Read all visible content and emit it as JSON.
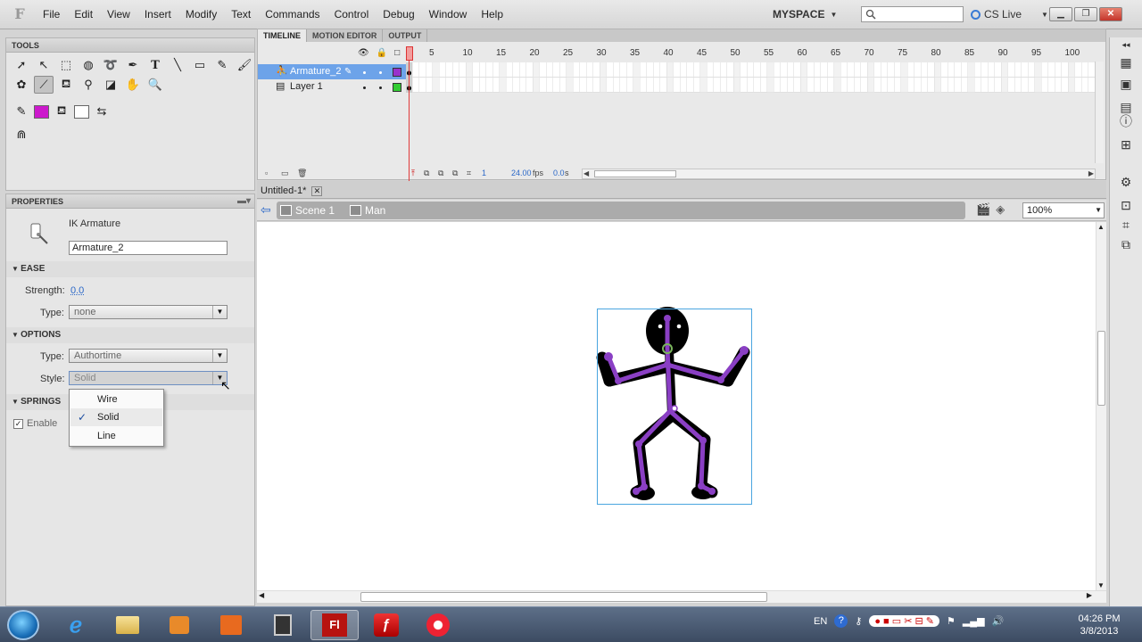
{
  "menu": {
    "items": [
      "File",
      "Edit",
      "View",
      "Insert",
      "Modify",
      "Text",
      "Commands",
      "Control",
      "Debug",
      "Window",
      "Help"
    ],
    "workspace": "MYSPACE",
    "search_placeholder": "",
    "cs_live": "CS Live"
  },
  "tools_panel": {
    "title": "TOOLS",
    "stroke_color": "#cc19cc",
    "fill_color": "#ffffff"
  },
  "properties": {
    "title": "PROPERTIES",
    "object_type": "IK Armature",
    "name_value": "Armature_2",
    "ease": {
      "heading": "EASE",
      "strength_label": "Strength:",
      "strength_value": "0.0",
      "type_label": "Type:",
      "type_value": "none"
    },
    "options": {
      "heading": "OPTIONS",
      "type_label": "Type:",
      "type_value": "Authortime",
      "style_label": "Style:",
      "style_value": "Solid"
    },
    "springs": {
      "heading": "SPRINGS",
      "enable_label": "Enable",
      "enable_checked": true
    },
    "style_dropdown": {
      "options": [
        "Wire",
        "Solid",
        "Line"
      ],
      "selected": "Solid"
    }
  },
  "timeline": {
    "tabs": [
      "TIMELINE",
      "MOTION EDITOR",
      "OUTPUT"
    ],
    "active_tab": "TIMELINE",
    "ruler": [
      "1",
      "5",
      "10",
      "15",
      "20",
      "25",
      "30",
      "35",
      "40",
      "45",
      "50",
      "55",
      "60",
      "65",
      "70",
      "75",
      "80",
      "85",
      "90",
      "95",
      "100"
    ],
    "layers": [
      {
        "name": "Armature_2",
        "color": "#9933cc",
        "selected": true
      },
      {
        "name": "Layer 1",
        "color": "#33cc33",
        "selected": false
      }
    ],
    "status": {
      "frame": "1",
      "fps": "24.00",
      "fps_unit": "fps",
      "time": "0.0",
      "time_unit": "s"
    }
  },
  "document": {
    "tab_title": "Untitled-1*",
    "breadcrumbs": [
      "Scene 1",
      "Man"
    ],
    "zoom": "100%"
  },
  "taskbar": {
    "apps": [
      "Internet Explorer",
      "File Explorer",
      "Media Player",
      "Office",
      "Calculator",
      "Fl",
      "Flash Player",
      "Recorder"
    ],
    "lang": "EN",
    "time": "04:26 PM",
    "date": "3/8/2013"
  },
  "colors": {
    "accent": "#6da3e9",
    "armature": "#8a3fc4",
    "playhead": "#e03a3a"
  }
}
